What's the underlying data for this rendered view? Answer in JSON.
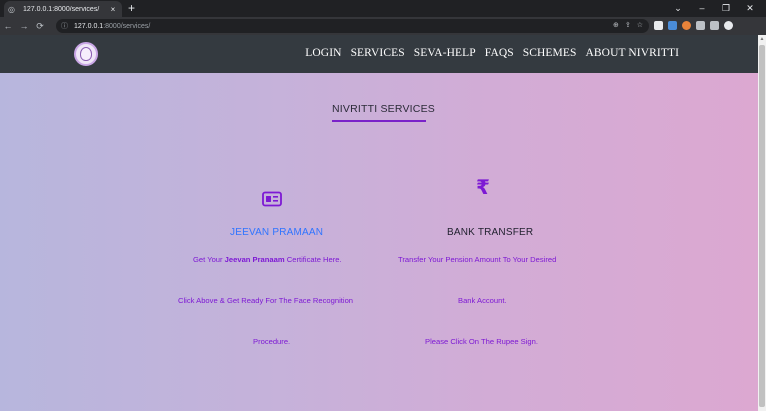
{
  "browser": {
    "tab_title": "127.0.0.1:8000/services/",
    "tab_close": "×",
    "new_tab": "+",
    "url_host": "127.0.0.1",
    "url_path": ":8000/services/",
    "window_controls": [
      "⌄",
      "–",
      "❐",
      "✕"
    ]
  },
  "nav": {
    "links": [
      "LOGIN",
      "SERVICES",
      "SEVA-HELP",
      "FAQS",
      "SCHEMES",
      "ABOUT NIVRITTI"
    ]
  },
  "section": {
    "title": "NIVRITTI SERVICES"
  },
  "cards": {
    "jeevan": {
      "title": "JEEVAN PRAMAAN",
      "line1_pre": "Get Your ",
      "line1_bold": "Jeevan Pranaam",
      "line1_post": " Certificate Here.",
      "line2": "Click Above & Get Ready For The Face Recognition",
      "line3": "Procedure."
    },
    "bank": {
      "title": "BANK TRANSFER",
      "icon_glyph": "₹",
      "line1": "Transfer Your Pension Amount To Your Desired",
      "line2": "Bank Account.",
      "line3": "Please Click On The Rupee Sign."
    }
  },
  "colors": {
    "accent": "#7d19d4",
    "link_blue": "#2f74ff",
    "navbar": "#343a40"
  }
}
